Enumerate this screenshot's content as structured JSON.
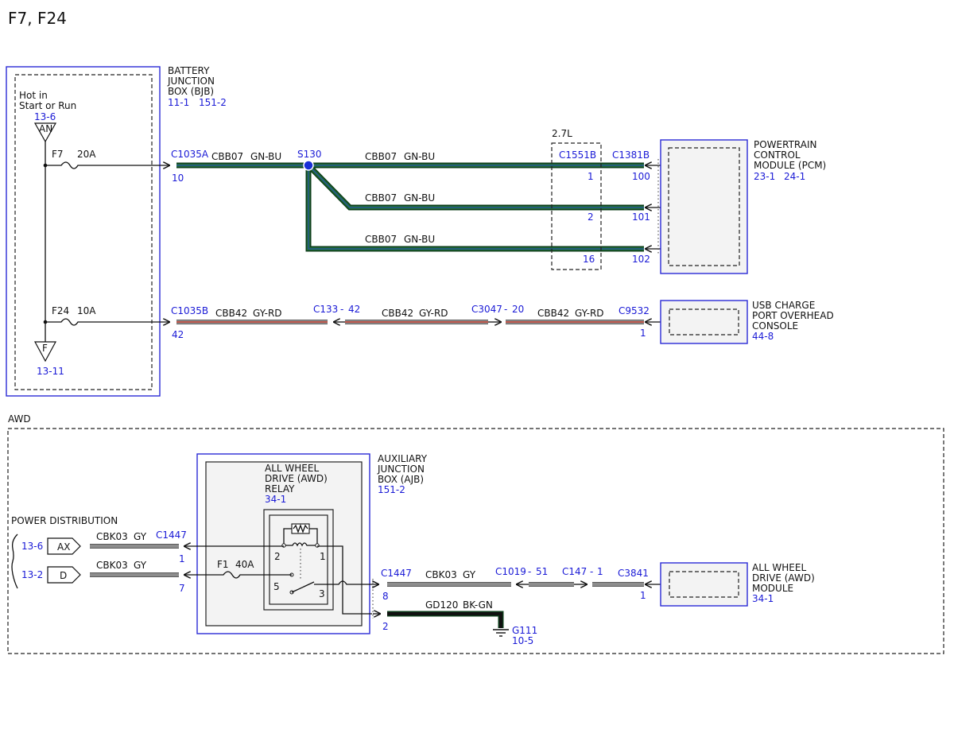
{
  "page_title": "F7, F24",
  "bjb": {
    "title_lines": [
      "BATTERY",
      "JUNCTION",
      "BOX (BJB)"
    ],
    "ref_a": "11-1",
    "ref_b": "151-2"
  },
  "hot": {
    "line1": "Hot in",
    "line2": "Start or Run",
    "ref_top": "13-6",
    "terminal_an": "AN",
    "terminal_f": "F",
    "ref_bottom": "13-11"
  },
  "fuses": {
    "f7": {
      "name": "F7",
      "rating": "20A"
    },
    "f24": {
      "name": "F24",
      "rating": "10A"
    },
    "f1": {
      "name": "F1",
      "rating": "40A"
    }
  },
  "upper_circuit": {
    "c1035a": "C1035A",
    "c1035a_pin": "10",
    "splice": "S130",
    "label_circuit": "CBB07",
    "label_color": "GN-BU",
    "engine": "2.7L",
    "c1551b": "C1551B",
    "c1551b_pins": [
      "1",
      "2",
      "16"
    ],
    "c1381b": "C1381B",
    "c1381b_pins": [
      "100",
      "101",
      "102"
    ]
  },
  "pcm": {
    "title_lines": [
      "POWERTRAIN",
      "CONTROL",
      "MODULE (PCM)"
    ],
    "ref_a": "23-1",
    "ref_b": "24-1"
  },
  "usb_circuit": {
    "c1035b": "C1035B",
    "c1035b_pin": "42",
    "label_circuit": "CBB42",
    "label_color": "GY-RD",
    "c133": "C133",
    "c133_pin": "42",
    "c3047": "C3047",
    "c3047_pin": "20",
    "c9532": "C9532",
    "c9532_pin": "1"
  },
  "usb_module": {
    "title_lines": [
      "USB CHARGE",
      "PORT OVERHEAD",
      "CONSOLE"
    ],
    "ref": "44-8"
  },
  "awd_section": {
    "label": "AWD"
  },
  "ajb": {
    "title_lines": [
      "AUXILIARY",
      "JUNCTION",
      "BOX (AJB)"
    ],
    "ref": "151-2"
  },
  "relay": {
    "title_lines": [
      "ALL WHEEL",
      "DRIVE (AWD)",
      "RELAY"
    ],
    "ref": "34-1",
    "pins": [
      "2",
      "1",
      "5",
      "3"
    ]
  },
  "power_distribution": {
    "label": "POWER DISTRIBUTION",
    "ref_ax": "13-6",
    "terminal_ax": "AX",
    "ref_d": "13-2",
    "terminal_d": "D"
  },
  "awd_circuit": {
    "label_circuit": "CBK03",
    "label_color": "GY",
    "c1447": "C1447",
    "c1447_pins": [
      "1",
      "7",
      "8",
      "2"
    ],
    "c1019": "C1019",
    "c1019_pin": "51",
    "c147": "C147",
    "c147_pin": "1",
    "c3841": "C3841",
    "c3841_pin": "1",
    "ground_circuit": "GD120",
    "ground_color": "BK-GN",
    "ground": "G111",
    "ground_ref": "10-5"
  },
  "awd_module": {
    "title_lines": [
      "ALL WHEEL",
      "DRIVE (AWD)",
      "MODULE"
    ],
    "ref": "34-1"
  },
  "colors": {
    "wire_green": "#1f6b34",
    "wire_green_edge": "#0d3d1b",
    "wire_blue": "#2a4dbf",
    "wire_gray": "#8d8d8d",
    "wire_gray_edge": "#5a5a5a",
    "wire_red": "#c0392b",
    "wire_black": "#111111",
    "label_blue": "#1a1ad6",
    "module_border": "#2a2ad6"
  }
}
